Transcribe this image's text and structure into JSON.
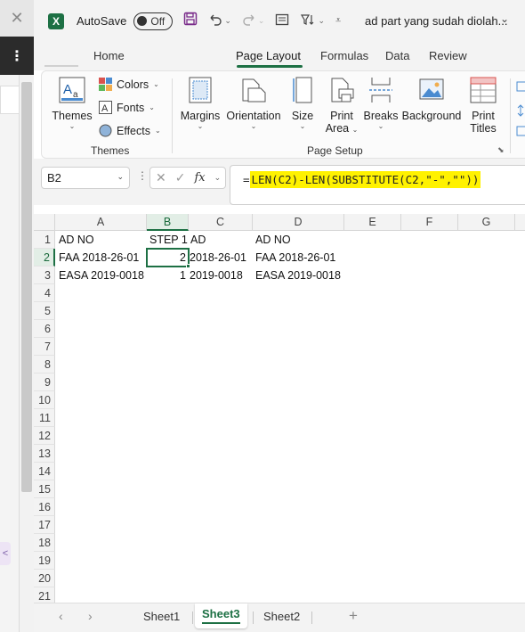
{
  "side": {
    "close_glyph": "✕",
    "menu_glyph": "⋮",
    "chip_glyph": "<"
  },
  "titlebar": {
    "logo_letter": "X",
    "autosave_label": "AutoSave",
    "toggle_state": "Off",
    "doc_title": "ad part yang sudah diolah...",
    "title_chevron": "⌄"
  },
  "tabs": [
    "Home",
    "Page Layout",
    "Formulas",
    "Data",
    "Review"
  ],
  "active_tab": "Page Layout",
  "ribbon": {
    "themes_group": {
      "label": "Themes",
      "themes_button": "Themes",
      "colors": "Colors",
      "fonts": "Fonts",
      "effects": "Effects"
    },
    "page_setup_group": {
      "label": "Page Setup",
      "margins": "Margins",
      "orientation": "Orientation",
      "size": "Size",
      "print_area_1": "Print",
      "print_area_2": "Area",
      "breaks": "Breaks",
      "background": "Background",
      "print_titles_1": "Print",
      "print_titles_2": "Titles"
    }
  },
  "formula_bar": {
    "name_box": "B2",
    "formula_prefix": "=",
    "formula_highlighted": "LEN(C2)-LEN(SUBSTITUTE(C2,\"-\",\"\"))",
    "highlight_color": "#fff200"
  },
  "grid": {
    "columns": [
      "A",
      "B",
      "C",
      "D",
      "E",
      "F",
      "G"
    ],
    "selected_column": "B",
    "rows": [
      "1",
      "2",
      "3",
      "4",
      "5",
      "6",
      "7",
      "8",
      "9",
      "10",
      "11",
      "12",
      "13",
      "14",
      "15",
      "16",
      "17",
      "18",
      "19",
      "20",
      "21"
    ],
    "selected_row": "2",
    "cells": {
      "A1": "AD NO",
      "B1": "STEP 1",
      "C1": "AD",
      "D1": "AD NO",
      "A2": "FAA 2018-26-01",
      "B2": "2",
      "C2": "2018-26-01",
      "D2": "FAA 2018-26-01",
      "A3": "EASA 2019-0018",
      "B3": "1",
      "C3": "2019-0018",
      "D3": "EASA 2019-0018"
    },
    "active_cell": "B2"
  },
  "sheets": [
    "Sheet1",
    "Sheet3",
    "Sheet2"
  ],
  "active_sheet": "Sheet3",
  "sheet_nav": {
    "prev": "‹",
    "next": "›",
    "add": "+"
  },
  "accent_color": "#1d7044"
}
